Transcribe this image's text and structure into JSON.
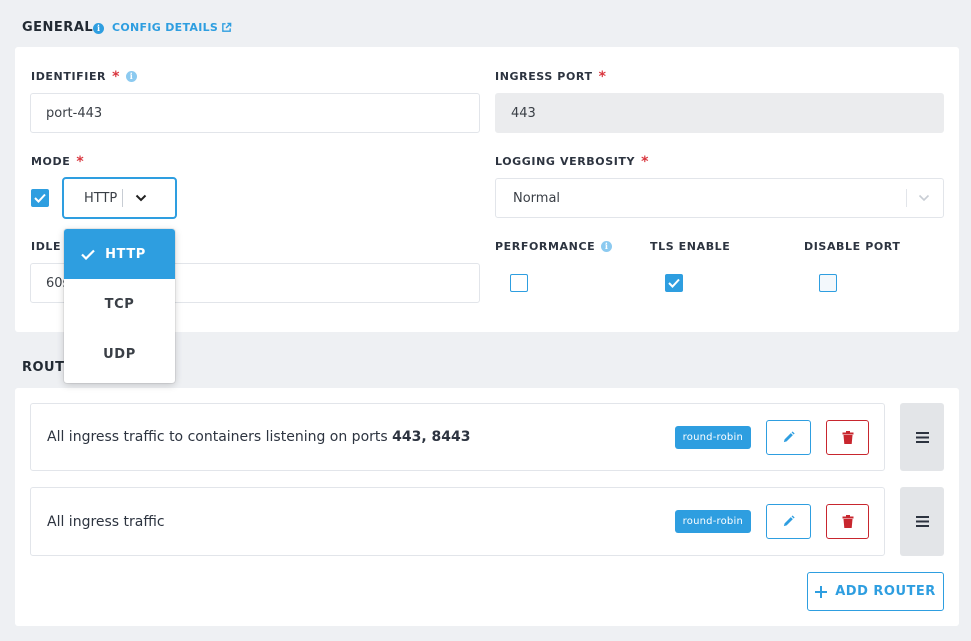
{
  "general": {
    "title": "GENERAL",
    "config_link": "CONFIG DETAILS"
  },
  "fields": {
    "identifier": {
      "label": "IDENTIFIER",
      "value": "port-443"
    },
    "ingress_port": {
      "label": "INGRESS PORT",
      "value": "443"
    },
    "mode": {
      "label": "MODE",
      "value": "HTTP",
      "enabled": true
    },
    "logging": {
      "label": "LOGGING VERBOSITY",
      "value": "Normal"
    },
    "idle_timeout": {
      "label": "IDLE T",
      "value": "60s"
    },
    "performance": {
      "label": "PERFORMANCE",
      "checked": false
    },
    "tls_enable": {
      "label": "TLS ENABLE",
      "checked": true
    },
    "disable_port": {
      "label": "DISABLE PORT",
      "checked": false
    }
  },
  "mode_dropdown": {
    "options": [
      "HTTP",
      "TCP",
      "UDP"
    ],
    "selected": "HTTP"
  },
  "routers": {
    "title": "ROUT",
    "items": [
      {
        "text": "All ingress traffic to containers listening on ports ",
        "ports": "443, 8443",
        "badge": "round-robin"
      },
      {
        "text": "All ingress traffic",
        "ports": "",
        "badge": "round-robin"
      }
    ],
    "add_label": "ADD ROUTER"
  },
  "colors": {
    "accent": "#2e9ee0",
    "danger": "#c8262e",
    "required": "#d9363e"
  },
  "icons": {
    "info": "info-icon",
    "external_link": "external-link-icon",
    "check": "check-icon",
    "chevron_down": "chevron-down-icon",
    "edit": "pencil-icon",
    "delete": "trash-icon",
    "drag": "hamburger-icon",
    "add": "plus-icon"
  }
}
